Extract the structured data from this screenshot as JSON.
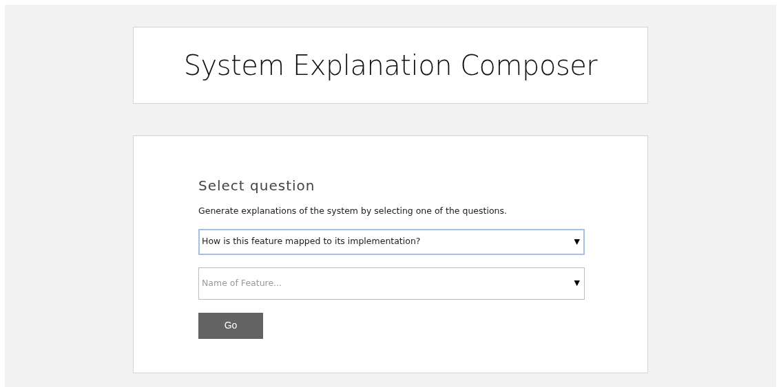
{
  "header": {
    "title": "System Explanation Composer"
  },
  "form": {
    "heading": "Select question",
    "description": "Generate explanations of the system by selecting one of the questions.",
    "question_select": {
      "value": "How is this feature mapped to its implementation?",
      "arrow": "▼",
      "focused": true
    },
    "feature_combo": {
      "placeholder": "Name of Feature...",
      "arrow": "▼",
      "focused": false
    },
    "button": "Go"
  }
}
